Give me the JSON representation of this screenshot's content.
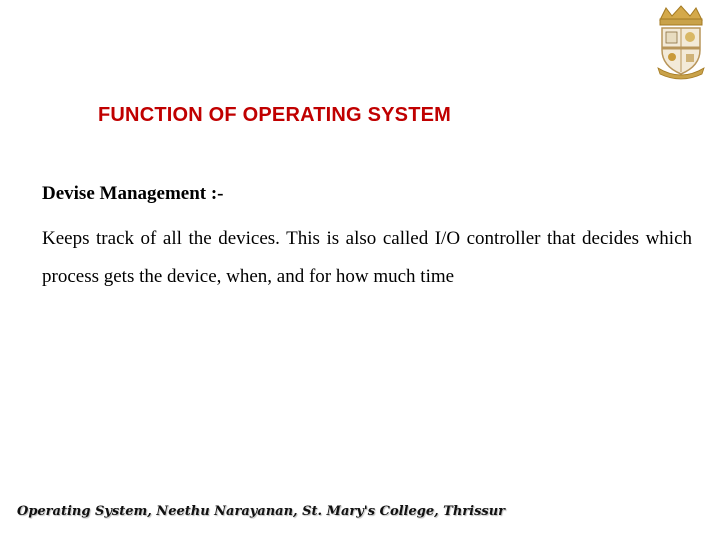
{
  "slide": {
    "logo": "college-crest",
    "title": "FUNCTION OF OPERATING SYSTEM",
    "subheading": "Devise Management :-",
    "paragraph": "Keeps track of all the devices. This is also called I/O controller that decides which process gets the device, when, and for how much time",
    "footer": "Operating System, Neethu Narayanan, St. Mary's College, Thrissur",
    "colors": {
      "title": "#c00000",
      "crown": "#c9a24a"
    }
  }
}
